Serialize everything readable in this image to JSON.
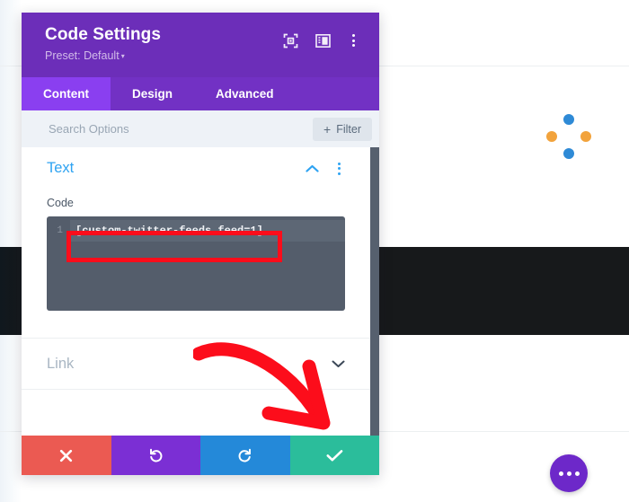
{
  "background": {
    "spinner": {
      "name": "loading-spinner",
      "dot_color_primary": "#2e8ad6",
      "dot_color_secondary": "#f2a33c"
    },
    "fab": {
      "name": "more-options-fab",
      "color": "#6d28c9",
      "icon": "ellipsis-horizontal-icon"
    },
    "band_color": "#17191b"
  },
  "modal": {
    "header": {
      "title": "Code Settings",
      "preset_label": "Preset: Default",
      "preset_caret": "▾",
      "background": "#6c2eb9",
      "icons": [
        {
          "name": "focus-target-icon",
          "label": "Focus"
        },
        {
          "name": "panel-layout-icon",
          "label": "Layout"
        },
        {
          "name": "overflow-menu-icon",
          "label": "More"
        }
      ]
    },
    "tabs": [
      {
        "label": "Content",
        "active": true
      },
      {
        "label": "Design",
        "active": false
      },
      {
        "label": "Advanced",
        "active": false
      }
    ],
    "search": {
      "placeholder": "Search Options",
      "value": "",
      "filter_label": "Filter",
      "filter_plus": "+"
    },
    "sections": [
      {
        "title": "Text",
        "expanded": true,
        "chevron": "chevron-up-icon",
        "field_label": "Code",
        "code": {
          "line_number": "1",
          "content": "[custom-twitter-feeds feed=1]"
        }
      },
      {
        "title": "Link",
        "expanded": false,
        "chevron": "chevron-down-icon"
      }
    ],
    "footer": [
      {
        "name": "cancel-button",
        "icon": "close-x-icon",
        "glyph": "✖",
        "color": "#eb5a52"
      },
      {
        "name": "undo-button",
        "icon": "undo-arrow-icon",
        "glyph": "↺",
        "color": "#7b2fd4"
      },
      {
        "name": "redo-button",
        "icon": "redo-arrow-icon",
        "glyph": "↻",
        "color": "#2489d9"
      },
      {
        "name": "save-button",
        "icon": "checkmark-icon",
        "glyph": "✔",
        "color": "#2bbd9b"
      }
    ]
  },
  "annotations": {
    "highlight_box_color": "#fc0d1b",
    "arrow_color": "#fc0d1b",
    "arrow_points_to": "save-button"
  }
}
